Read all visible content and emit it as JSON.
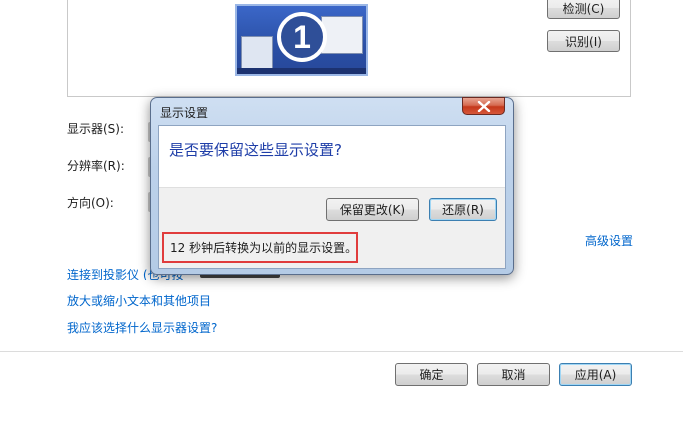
{
  "buttons": {
    "detect": "检测(C)",
    "identify": "识别(I)"
  },
  "monitor": {
    "number": "1"
  },
  "labels": {
    "display": "显示器(S):",
    "resolution": "分辨率(R):",
    "orientation": "方向(O):"
  },
  "links": {
    "advanced": "高级设置",
    "projector": "连接到投影仪 (也可按",
    "text_size": "放大或缩小文本和其他项目",
    "which_settings": "我应该选择什么显示器设置?"
  },
  "footer": {
    "ok": "确定",
    "cancel": "取消",
    "apply": "应用(A)"
  },
  "dialog": {
    "title": "显示设置",
    "question": "是否要保留这些显示设置?",
    "keep": "保留更改(K)",
    "revert": "还原(R)",
    "countdown": "12 秒钟后转换为以前的显示设置。"
  },
  "icons": {
    "close": "close-icon"
  }
}
